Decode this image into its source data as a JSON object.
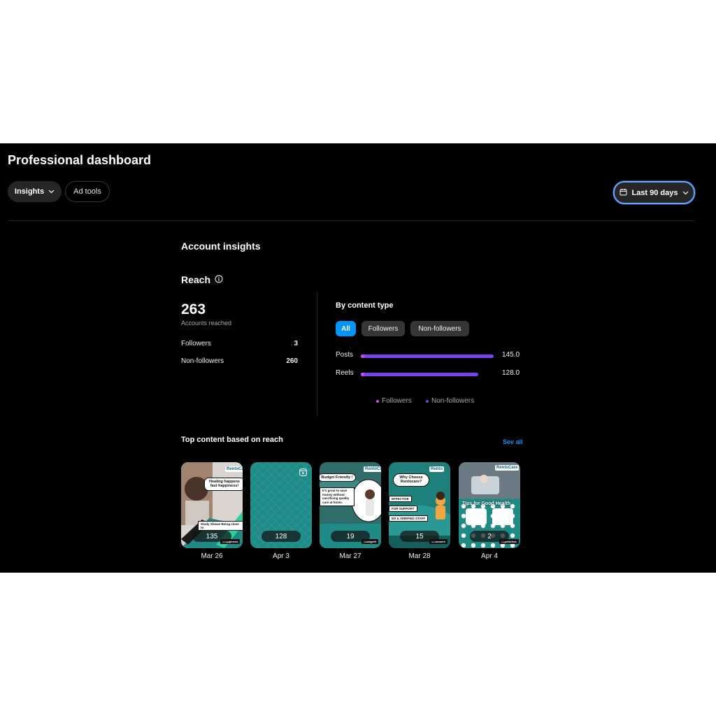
{
  "header": {
    "title": "Professional dashboard",
    "tabs": [
      {
        "label": "Insights"
      },
      {
        "label": "Ad tools"
      }
    ],
    "date_range": {
      "label": "Last 90 days"
    }
  },
  "account_insights": {
    "title": "Account insights",
    "reach": {
      "title": "Reach",
      "total": "263",
      "total_label": "Accounts reached",
      "rows": [
        {
          "label": "Followers",
          "value": "3"
        },
        {
          "label": "Non-followers",
          "value": "260"
        }
      ]
    },
    "by_content_type": {
      "title": "By content type",
      "filters": [
        {
          "label": "All",
          "selected": true
        },
        {
          "label": "Followers",
          "selected": false
        },
        {
          "label": "Non-followers",
          "selected": false
        }
      ],
      "legend": [
        {
          "label": "Followers",
          "color": "#d946ef"
        },
        {
          "label": "Non-followers",
          "color": "#7b3ff2"
        }
      ]
    }
  },
  "chart_data": {
    "type": "bar",
    "orientation": "horizontal",
    "categories": [
      "Posts",
      "Reels"
    ],
    "values": [
      145.0,
      128.0
    ],
    "value_labels": [
      "145.0",
      "128.0"
    ],
    "series": [
      {
        "name": "Followers",
        "color": "#d946ef"
      },
      {
        "name": "Non-followers",
        "color": "#7b3ff2"
      }
    ],
    "xlim": [
      0,
      145
    ]
  },
  "top_content": {
    "title": "Top content based on reach",
    "see_all": "See all",
    "items": [
      {
        "count": "135",
        "date": "Mar 26",
        "brand": "RentoCa",
        "bubble": "Healing happens fast happiness!",
        "strip": "Study Shows Being close to",
        "caption": "#Happiness"
      },
      {
        "count": "128",
        "date": "Apr 3"
      },
      {
        "count": "19",
        "date": "Mar 27",
        "brand": "RentoCa",
        "bubble": "Budget Friendly !",
        "strip": "It's great to save money without sacrificing quality care at home.",
        "caption": "#budgetfr"
      },
      {
        "count": "15",
        "date": "Mar 28",
        "brand": "Rento",
        "bubble": "Why Choose Rentocare?",
        "strip": "EFFECTIVE",
        "strip2": "FOR SUPPORT",
        "strip3": "ED & VERIFIED STAFF",
        "caption": "#choosere"
      },
      {
        "count": "2",
        "date": "Apr 4",
        "brand": "RentoCare",
        "banner": "Tips for Good Health",
        "caption": "#tipsforhea"
      }
    ]
  },
  "colors": {
    "accent": "#0095f6",
    "posts_bar": "#7b3ff2",
    "followers_dot": "#d946ef",
    "teal": "#1f8a86"
  }
}
